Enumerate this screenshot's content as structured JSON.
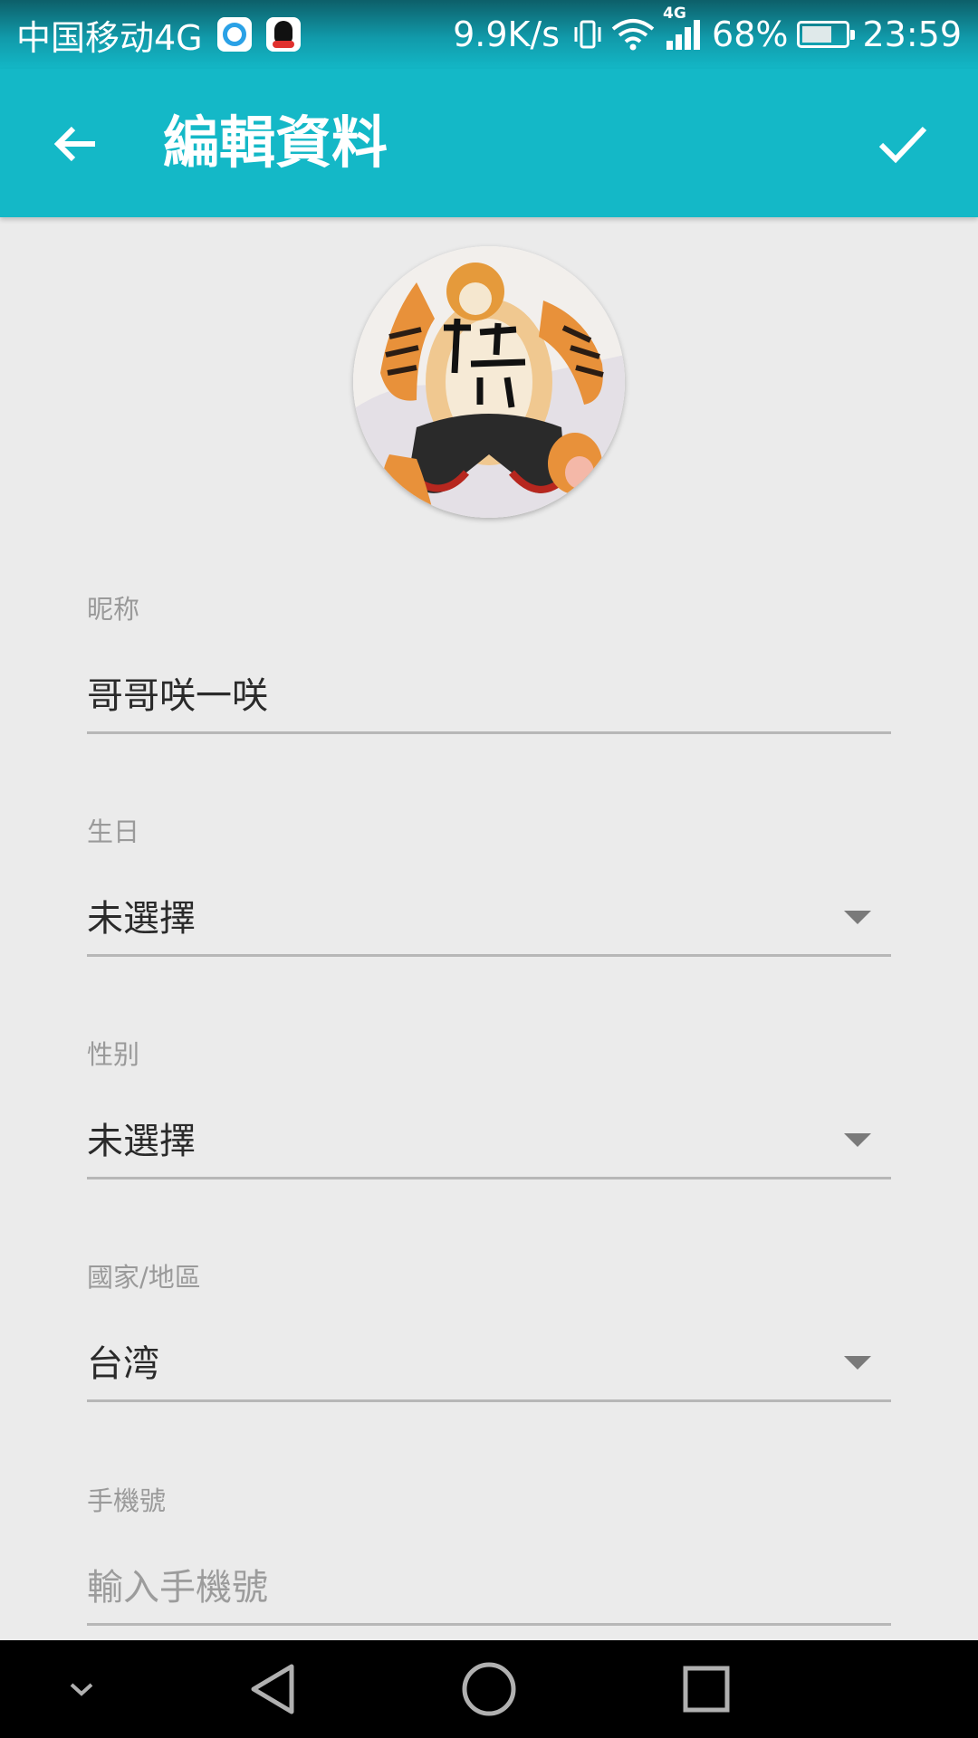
{
  "status_bar": {
    "carrier": "中国移动4G",
    "net_speed": "9.9K/s",
    "network_type": "4G",
    "battery": "68%",
    "battery_level": 0.68,
    "time": "23:59"
  },
  "toolbar": {
    "title": "編輯資料"
  },
  "form": {
    "nickname": {
      "label": "昵称",
      "value": "哥哥咲一咲"
    },
    "birthday": {
      "label": "生日",
      "value": "未選擇"
    },
    "gender": {
      "label": "性别",
      "value": "未選擇"
    },
    "region": {
      "label": "國家/地區",
      "value": "台湾"
    },
    "phone": {
      "label": "手機號",
      "placeholder": "輸入手機號"
    }
  },
  "colors": {
    "primary": "#14b8c7",
    "background": "#ebebeb",
    "label": "#9a9a9a",
    "text": "#2a2a2a",
    "divider": "#b7b7b7"
  },
  "icons": {
    "back": "arrow-left-icon",
    "done": "checkmark-icon",
    "dropdown": "triangle-down-icon",
    "nav_menu": "chevron-down-icon",
    "nav_back": "triangle-back-icon",
    "nav_home": "circle-home-icon",
    "nav_recents": "square-recents-icon"
  }
}
